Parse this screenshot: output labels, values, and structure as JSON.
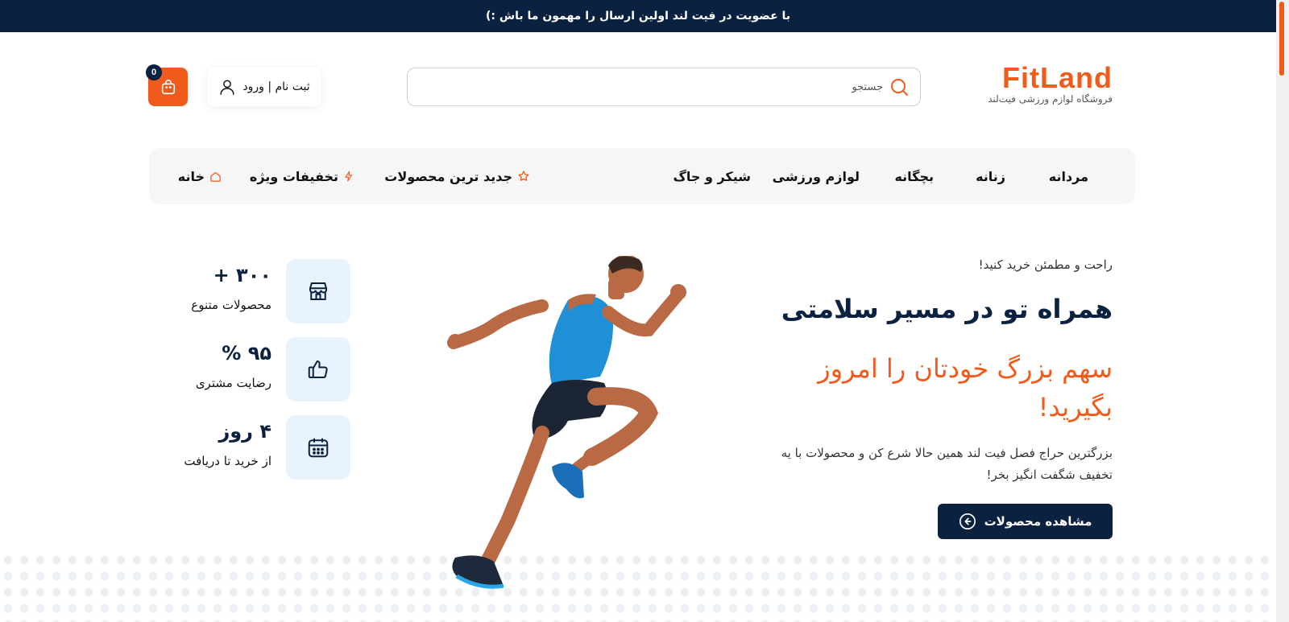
{
  "announcement": "با عضویت در فیت لند اولین ارسال را مهمون ما باش :)",
  "logo": {
    "brand": "FitLand",
    "tagline": "فروشگاه لوازم ورزشی فیت‌لند"
  },
  "search": {
    "placeholder": "جستجو"
  },
  "auth": {
    "label": "ثبت نام | ورود"
  },
  "cart": {
    "count": "0"
  },
  "nav": {
    "categories": [
      "مردانه",
      "زنانه",
      "بچگانه",
      "لوازم ورزشی",
      "شیکر و جاگ"
    ],
    "newest": "جدید ترین محصولات",
    "offers": "تخفیفات ویژه",
    "home": "خانه"
  },
  "hero": {
    "subtitle": "راحت و مطمئن خرید کنید!",
    "title": "همراه تو در مسیر سلامتی",
    "highlight": "سهم بزرگ خودتان را امروز بگیرید!",
    "description": "بزرگترین حراج فصل فیت لند همین حالا شرع کن و محصولات با یه تخفیف شگفت انگیز بخر!",
    "cta": "مشاهده محصولات"
  },
  "stats": [
    {
      "value": "۳۰۰ +",
      "label": "محصولات متنوع",
      "icon": "store-icon"
    },
    {
      "value": "۹۵ %",
      "label": "رضایت مشتری",
      "icon": "thumbs-up-icon"
    },
    {
      "value": "۴ روز",
      "label": "از خرید تا دریافت",
      "icon": "calendar-icon"
    }
  ],
  "colors": {
    "accent": "#f05a1a",
    "navy": "#0a2240",
    "statBox": "#e8f3fd"
  }
}
